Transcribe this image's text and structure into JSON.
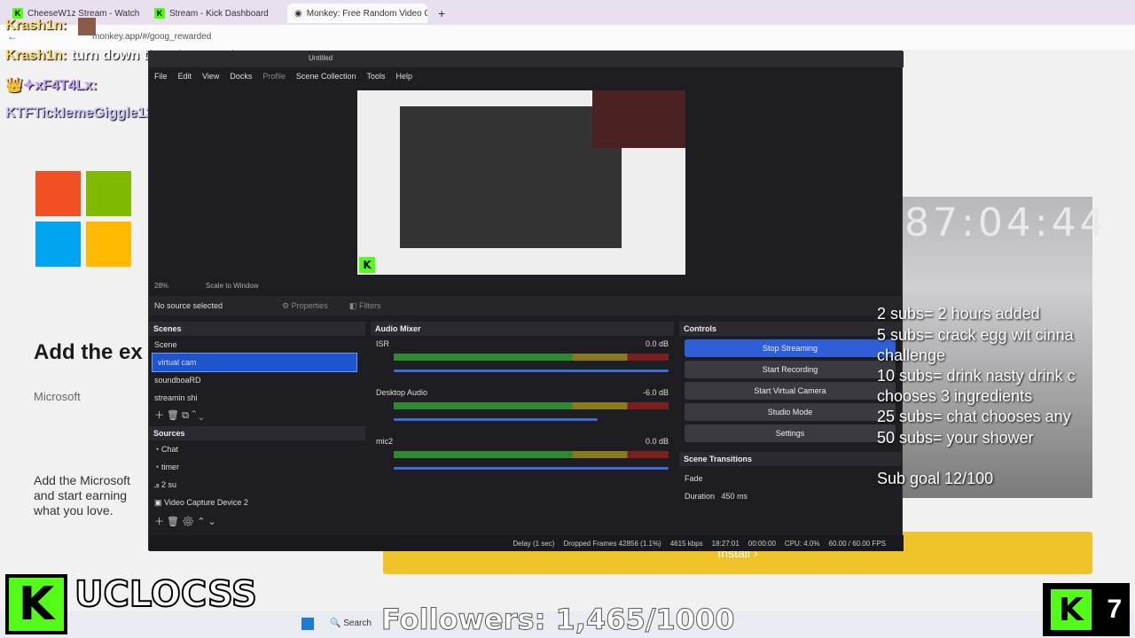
{
  "browser": {
    "tabs": [
      {
        "label": "CheeseW1z Stream - Watch"
      },
      {
        "label": "Stream - Kick Dashboard"
      },
      {
        "label": "Monkey: Free Random Video C"
      }
    ],
    "new_tab": "+",
    "url": "monkey.app/#/goog_rewarded"
  },
  "page": {
    "heading": "Add the ex",
    "publisher": "Microsoft",
    "body": "Add the Microsoft and start earning what you love.",
    "install_label": "Install"
  },
  "chat": [
    {
      "user": "Krash1n:",
      "text": ""
    },
    {
      "user": "Krash1n:",
      "text": "turn down the cheese nigga."
    },
    {
      "user": "xF4T4Lx:",
      "text": ""
    },
    {
      "user": "KTFTickIemeGiggle12:",
      "text": ""
    }
  ],
  "obs": {
    "title": "Untitled",
    "menu": [
      "File",
      "Edit",
      "View",
      "Docks",
      "Profile",
      "Scene Collection",
      "Tools",
      "Help"
    ],
    "zoom": "28%",
    "scale": "Scale to Window",
    "no_source": "No source selected",
    "properties": "Properties",
    "filters": "Filters",
    "scenes_title": "Scenes",
    "scenes": [
      "Scene",
      "virtual cam",
      "soundboaRD",
      "streamin shi"
    ],
    "sources_title": "Sources",
    "sources": [
      "Chat",
      "timer",
      "2 su",
      "Video Capture Device 2"
    ],
    "mixer_title": "Audio Mixer",
    "channels": [
      {
        "name": "ISR",
        "db": "0.0 dB"
      },
      {
        "name": "Desktop Audio",
        "db": "-6.0 dB"
      },
      {
        "name": "mic2",
        "db": "0.0 dB"
      }
    ],
    "scale_ticks": [
      "-60",
      "-55",
      "-50",
      "-45",
      "-40",
      "-35",
      "-30",
      "-25",
      "-20",
      "-15",
      "-10",
      "-5",
      "0"
    ],
    "controls_title": "Controls",
    "controls": [
      "Stop Streaming",
      "Start Recording",
      "Start Virtual Camera",
      "Studio Mode",
      "Settings"
    ],
    "transitions_title": "Scene Transitions",
    "transition": "Fade",
    "duration_label": "Duration",
    "duration": "450 ms",
    "status": {
      "delay": "Delay (1 sec)",
      "dropped": "Dropped Frames 42856 (1.1%)",
      "kbps": "4615 kbps",
      "time": "18:27:01",
      "rec": "00:00:00",
      "cpu": "CPU: 4.0%",
      "fps": "60.00 / 60.00 FPS"
    }
  },
  "overlay": {
    "timer": "87:04:44",
    "goals": [
      "2 subs=  2 hours added",
      "5 subs= crack egg wit cinna",
      "challenge",
      "10 subs= drink nasty drink c",
      "chooses 3 ingredients",
      "25 subs= chat chooses any",
      "50 subs= your shower"
    ],
    "sub_goal": "Sub goal 12/100",
    "followers": "Followers: 1,465/1000",
    "brand": "UCLOCSS",
    "k": "K",
    "k7": "7"
  },
  "taskbar": {
    "search": "Search"
  },
  "colors": {
    "kick_green": "#53fc18",
    "accent_blue": "#2e5ed8",
    "install_yellow": "#f0c22a"
  }
}
